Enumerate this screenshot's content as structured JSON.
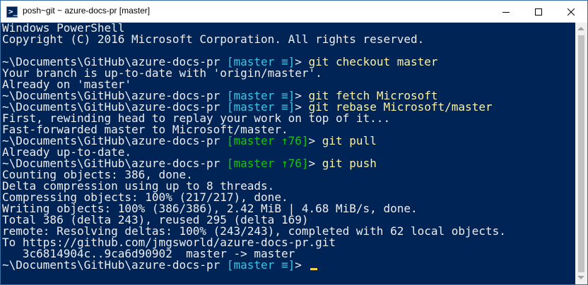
{
  "window": {
    "title": "posh~git ~ azure-docs-pr [master]"
  },
  "colors": {
    "terminal_bg": "#012456",
    "text": "#eeedf0",
    "branch": "#3ac6e8",
    "ahead": "#16c60c",
    "command": "#f9f1a5",
    "cursor": "#f9d24a"
  },
  "terminal": {
    "header_1": "Windows PowerShell",
    "header_2": "Copyright (C) 2016 Microsoft Corporation. All rights reserved.",
    "path": "~\\Documents\\GitHub\\azure-docs-pr",
    "prompt_end": ">",
    "branch_sync": "[master ≡]",
    "branch_ahead": "[master ↑76]",
    "commands": {
      "checkout": "git checkout master",
      "fetch": "git fetch Microsoft",
      "rebase": "git rebase Microsoft/master",
      "pull": "git pull",
      "push": "git push"
    },
    "outputs": {
      "checkout_1": "Your branch is up-to-date with 'origin/master'.",
      "checkout_2": "Already on 'master'",
      "rebase_1": "First, rewinding head to replay your work on top of it...",
      "rebase_2": "Fast-forwarded master to Microsoft/master.",
      "pull_1": "Already up-to-date.",
      "push_1": "Counting objects: 386, done.",
      "push_2": "Delta compression using up to 8 threads.",
      "push_3": "Compressing objects: 100% (217/217), done.",
      "push_4": "Writing objects: 100% (386/386), 2.42 MiB | 4.68 MiB/s, done.",
      "push_5": "Total 386 (delta 243), reused 295 (delta 169)",
      "push_6": "remote: Resolving deltas: 100% (243/243), completed with 62 local objects.",
      "push_7": "To https://github.com/jmgsworld/azure-docs-pr.git",
      "push_8": "   3c6814904c..9ca6d90902  master -> master"
    }
  }
}
